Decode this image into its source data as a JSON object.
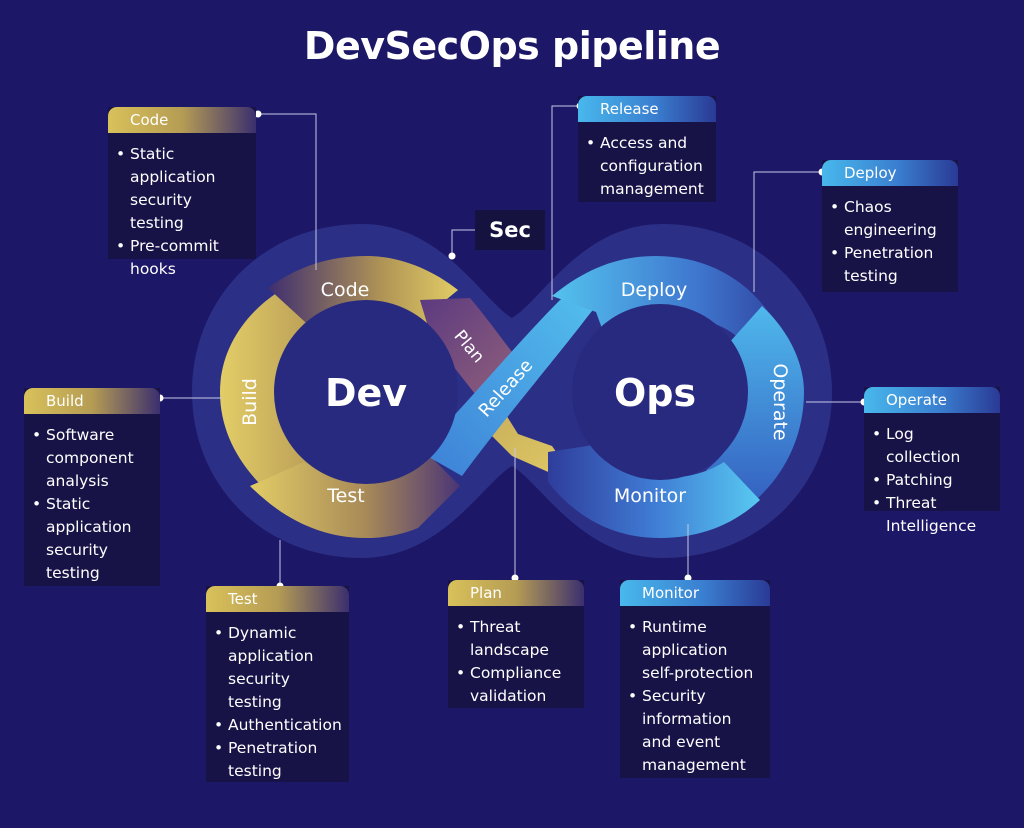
{
  "title": "DevSecOps pipeline",
  "center": {
    "dev": "Dev",
    "ops": "Ops",
    "sec": "Sec"
  },
  "loop_labels": {
    "code": "Code",
    "plan": "Plan",
    "build": "Build",
    "test": "Test",
    "release": "Release",
    "deploy": "Deploy",
    "operate": "Operate",
    "monitor": "Monitor"
  },
  "cards": {
    "code": {
      "title": "Code",
      "items": [
        "Static application security testing",
        "Pre-commit hooks"
      ]
    },
    "build": {
      "title": "Build",
      "items": [
        "Software component analysis",
        "Static application security testing"
      ]
    },
    "test": {
      "title": "Test",
      "items": [
        "Dynamic application security testing",
        "Authentication",
        "Penetration testing"
      ]
    },
    "plan": {
      "title": "Plan",
      "items": [
        "Threat landscape",
        "Compliance validation"
      ]
    },
    "release": {
      "title": "Release",
      "items": [
        "Access and configuration management"
      ]
    },
    "deploy": {
      "title": "Deploy",
      "items": [
        "Chaos engineering",
        "Penetration testing"
      ]
    },
    "operate": {
      "title": "Operate",
      "items": [
        "Log collection",
        "Patching",
        "Threat Intelligence"
      ]
    },
    "monitor": {
      "title": "Monitor",
      "items": [
        "Runtime application self-protection",
        "Security information and event management"
      ]
    }
  },
  "colors": {
    "background": "#1c1766",
    "card": "#171347",
    "ring": "#2a2d82",
    "dev_yellow": "#d9c15a",
    "ops_blue": "#48b8ec",
    "purple": "#6a3f86"
  }
}
